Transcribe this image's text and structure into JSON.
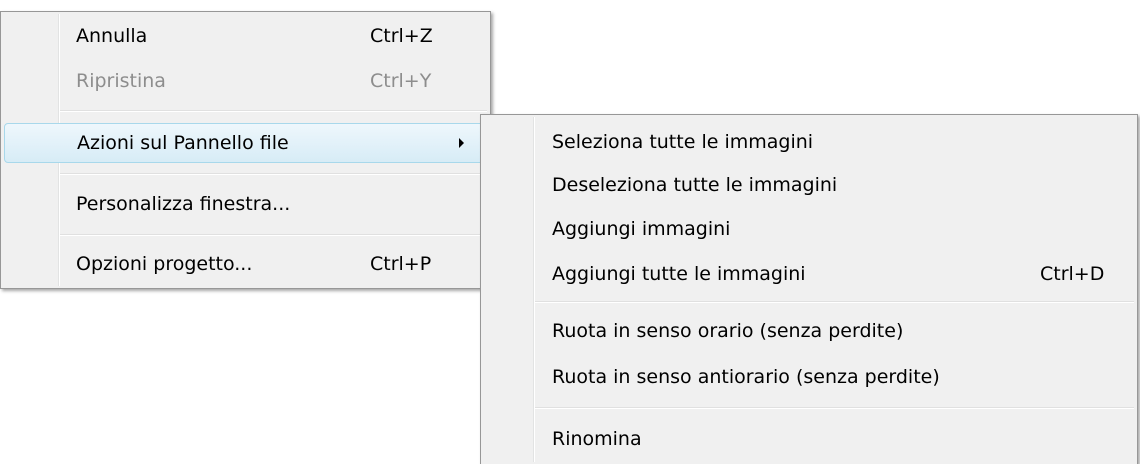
{
  "main_menu": {
    "items": [
      {
        "label": "Annulla",
        "shortcut": "Ctrl+Z"
      },
      {
        "label": "Ripristina",
        "shortcut": "Ctrl+Y"
      },
      {
        "label": "Azioni sul Pannello file",
        "shortcut": ""
      },
      {
        "label": "Personalizza finestra...",
        "shortcut": ""
      },
      {
        "label": "Opzioni progetto...",
        "shortcut": "Ctrl+P"
      }
    ]
  },
  "submenu": {
    "items": [
      {
        "label": "Seleziona tutte le immagini",
        "shortcut": ""
      },
      {
        "label": "Deseleziona tutte le immagini",
        "shortcut": ""
      },
      {
        "label": "Aggiungi immagini",
        "shortcut": ""
      },
      {
        "label": "Aggiungi tutte le immagini",
        "shortcut": "Ctrl+D"
      },
      {
        "label": "Ruota in senso orario (senza perdite)",
        "shortcut": ""
      },
      {
        "label": "Ruota in senso antiorario (senza perdite)",
        "shortcut": ""
      },
      {
        "label": "Rinomina",
        "shortcut": ""
      }
    ]
  },
  "colors": {
    "menu_background": "#f0f0f0",
    "highlight_border": "#a8d8eb",
    "disabled_text": "#8d8d8d"
  },
  "icons": {
    "submenu_arrow": "chevron-right-icon"
  }
}
